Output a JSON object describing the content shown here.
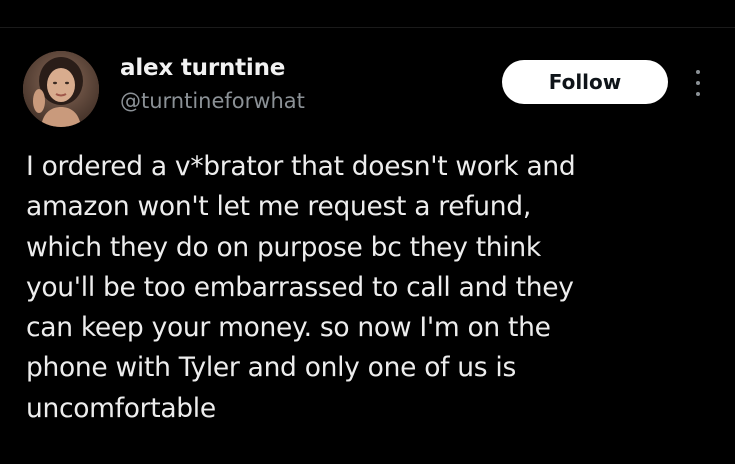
{
  "tweet": {
    "author": {
      "display_name": "alex turntine",
      "handle": "@turntineforwhat",
      "avatar_icon": "profile-photo"
    },
    "follow_label": "Follow",
    "more_icon": "more-vertical-icon",
    "text_lines": [
      "I ordered a v*brator that doesn't work and",
      "amazon won't let me request a refund,",
      "which they do on purpose bc they think",
      "you'll be too embarrassed to call and they",
      "can keep your money. so now I'm on the",
      "phone with Tyler and only one of us is",
      "uncomfortable"
    ]
  },
  "colors": {
    "background": "#000000",
    "text_primary": "#ededed",
    "text_secondary": "#8b9196",
    "follow_bg": "#ffffff",
    "follow_text": "#0f1419"
  }
}
